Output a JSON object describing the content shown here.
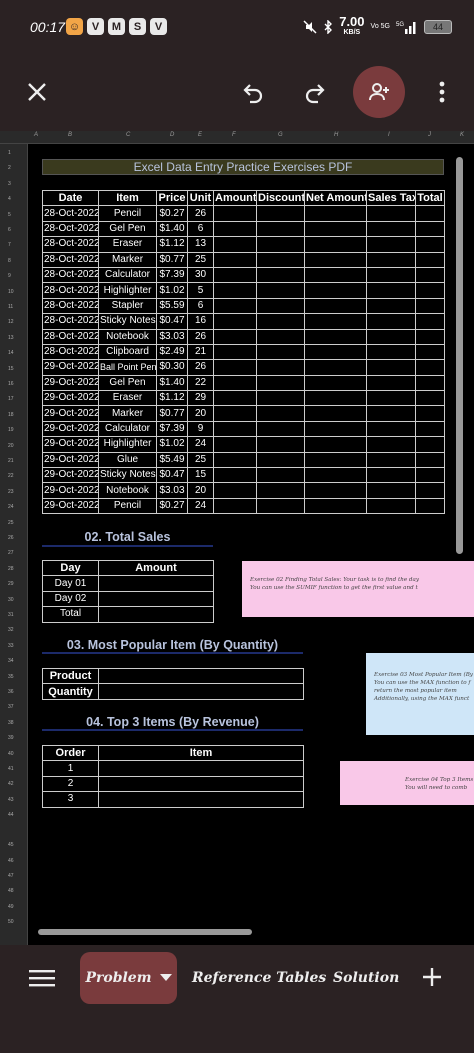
{
  "status_bar": {
    "time": "00:17",
    "app_icons": [
      "V",
      "M",
      "S",
      "V"
    ],
    "speed_value": "7.00",
    "speed_unit": "KB/S",
    "volte": "Vo 5G",
    "network": "5G",
    "battery": "44"
  },
  "toolbar": {
    "close_icon": "close-icon",
    "undo_icon": "undo-icon",
    "redo_icon": "redo-icon",
    "share_icon": "add-person-icon",
    "more_icon": "more-vert-icon"
  },
  "column_headers": [
    "A",
    "B",
    "C",
    "D",
    "E",
    "F",
    "G",
    "H",
    "I",
    "J",
    "K"
  ],
  "row_numbers": [
    "1",
    "2",
    "3",
    "4",
    "5",
    "6",
    "7",
    "8",
    "9",
    "10",
    "11",
    "12",
    "13",
    "14",
    "15",
    "16",
    "17",
    "18",
    "19",
    "20",
    "21",
    "22",
    "23",
    "24",
    "25",
    "26",
    "27",
    "28",
    "29",
    "30",
    "31",
    "32",
    "33",
    "34",
    "35",
    "36",
    "37",
    "38",
    "39",
    "40",
    "41",
    "42",
    "43",
    "44",
    "45",
    "46",
    "47",
    "48",
    "49",
    "50"
  ],
  "title": "Excel Data Entry Practice Exercises PDF",
  "main_table": {
    "headers": [
      "Date",
      "Item",
      "Price",
      "Unit",
      "Amount",
      "Discount",
      "Net Amount",
      "Sales Tax",
      "Total"
    ],
    "rows": [
      [
        "28-Oct-2022",
        "Pencil",
        "$0.27",
        "26"
      ],
      [
        "28-Oct-2022",
        "Gel Pen",
        "$1.40",
        "6"
      ],
      [
        "28-Oct-2022",
        "Eraser",
        "$1.12",
        "13"
      ],
      [
        "28-Oct-2022",
        "Marker",
        "$0.77",
        "25"
      ],
      [
        "28-Oct-2022",
        "Calculator",
        "$7.39",
        "30"
      ],
      [
        "28-Oct-2022",
        "Highlighter",
        "$1.02",
        "5"
      ],
      [
        "28-Oct-2022",
        "Stapler",
        "$5.59",
        "6"
      ],
      [
        "28-Oct-2022",
        "Sticky Notes",
        "$0.47",
        "16"
      ],
      [
        "28-Oct-2022",
        "Notebook",
        "$3.03",
        "26"
      ],
      [
        "28-Oct-2022",
        "Clipboard",
        "$2.49",
        "21"
      ],
      [
        "29-Oct-2022",
        "Ball Point Pen",
        "$0.30",
        "26"
      ],
      [
        "29-Oct-2022",
        "Gel Pen",
        "$1.40",
        "22"
      ],
      [
        "29-Oct-2022",
        "Eraser",
        "$1.12",
        "29"
      ],
      [
        "29-Oct-2022",
        "Marker",
        "$0.77",
        "20"
      ],
      [
        "29-Oct-2022",
        "Calculator",
        "$7.39",
        "9"
      ],
      [
        "29-Oct-2022",
        "Highlighter",
        "$1.02",
        "24"
      ],
      [
        "29-Oct-2022",
        "Glue",
        "$5.49",
        "25"
      ],
      [
        "29-Oct-2022",
        "Sticky Notes",
        "$0.47",
        "15"
      ],
      [
        "29-Oct-2022",
        "Notebook",
        "$3.03",
        "20"
      ],
      [
        "29-Oct-2022",
        "Pencil",
        "$0.27",
        "24"
      ]
    ]
  },
  "section2": {
    "title": "02. Total Sales",
    "headers": [
      "Day",
      "Amount"
    ],
    "rows": [
      "Day 01",
      "Day 02",
      "Total"
    ]
  },
  "section3": {
    "title": "03. Most Popular Item (By Quantity)",
    "rows": [
      "Product",
      "Quantity"
    ]
  },
  "section4": {
    "title": "04. Top 3 Items (By Revenue)",
    "headers": [
      "Order",
      "Item"
    ],
    "rows": [
      "1",
      "2",
      "3"
    ]
  },
  "notes": {
    "note2_line1": "Exercise 02 Finding Total Sales: Your task is to find the day",
    "note2_line2": "You can use the SUMIF function to get the first value and t",
    "note3_line1": "Exercise 03 Most Popular Item (By",
    "note3_line2": "You can use the MAX function to f",
    "note3_line3": "return the most popular item",
    "note3_line4": "Additionally, using the MAX funct",
    "note4_line1": "Exercise 04 Top 3 Items",
    "note4_line2": "You will need to comb"
  },
  "sheet_tabs": {
    "active": "Problem",
    "tab2": "Reference Tables",
    "tab3": "Solution"
  },
  "colors": {
    "chrome": "#2b2223",
    "accent": "#7a3b3d",
    "section_text": "#b8c3dd",
    "note_pink": "#f9c8e8",
    "note_blue": "#cfe6f8"
  }
}
